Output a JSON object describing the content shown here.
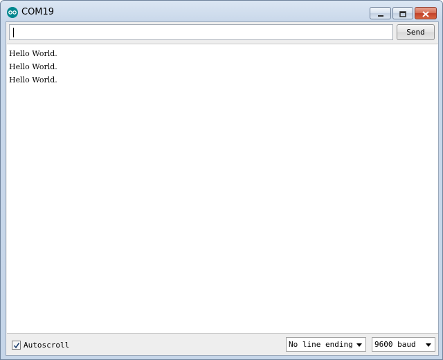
{
  "window": {
    "title": "COM19",
    "icon": "arduino-icon",
    "controls": [
      "minimize-icon",
      "maximize-icon",
      "close-icon"
    ]
  },
  "send": {
    "input_value": "",
    "button_label": "Send"
  },
  "output": {
    "lines": [
      "Hello World.",
      "Hello World.",
      "Hello World."
    ]
  },
  "footer": {
    "autoscroll_label": "Autoscroll",
    "autoscroll_checked": true,
    "line_ending": "No line ending",
    "baud": "9600 baud"
  },
  "colors": {
    "icon_teal": "#00878f",
    "close_red": "#c2412a"
  }
}
